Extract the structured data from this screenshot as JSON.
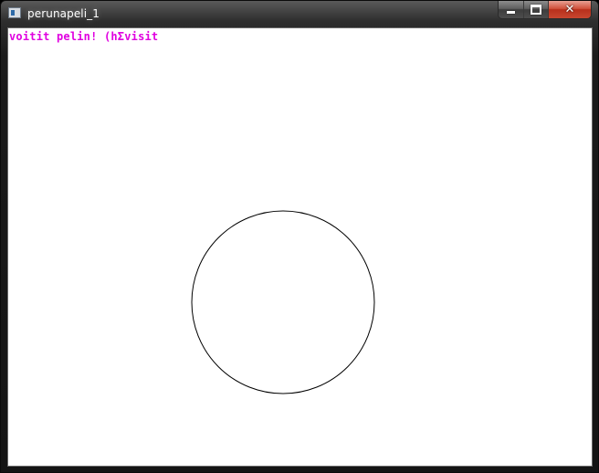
{
  "window": {
    "title": "perunapeli_1",
    "icon": "app-window-icon"
  },
  "controls": {
    "minimize_icon": "minimize-icon",
    "maximize_icon": "maximize-icon",
    "close_icon": "close-icon",
    "close_glyph": "✕"
  },
  "game": {
    "message": "voitit pelin! (hΣvisit",
    "message_color": "#e000e0",
    "circle_stroke": "#000000"
  }
}
